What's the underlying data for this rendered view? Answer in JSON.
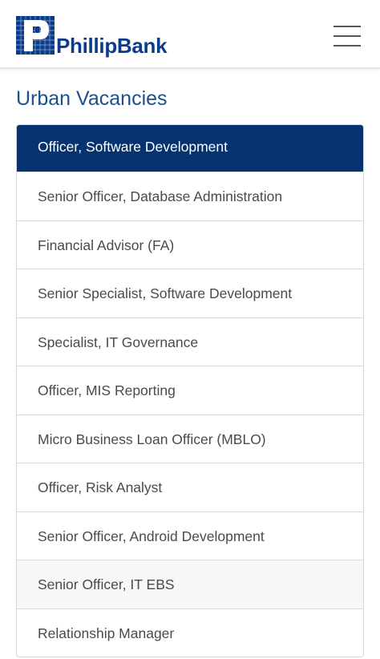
{
  "header": {
    "brand": "PhillipBank",
    "logo_letter": "P",
    "menu_icon": "hamburger-menu-icon"
  },
  "page": {
    "title": "Urban Vacancies"
  },
  "colors": {
    "brand_blue": "#0b3c8c",
    "active_bg": "#05336f",
    "title_blue": "#1b4f8d"
  },
  "vacancies": [
    {
      "label": "Officer, Software Development",
      "active": true
    },
    {
      "label": "Senior Officer, Database Administration"
    },
    {
      "label": "Financial Advisor (FA)"
    },
    {
      "label": "Senior Specialist, Software Development"
    },
    {
      "label": "Specialist, IT Governance"
    },
    {
      "label": "Officer, MIS Reporting"
    },
    {
      "label": "Micro Business Loan Officer (MBLO)"
    },
    {
      "label": "Officer, Risk Analyst"
    },
    {
      "label": "Senior Officer, Android Development"
    },
    {
      "label": "Senior Officer, IT EBS"
    },
    {
      "label": "Relationship Manager"
    }
  ]
}
